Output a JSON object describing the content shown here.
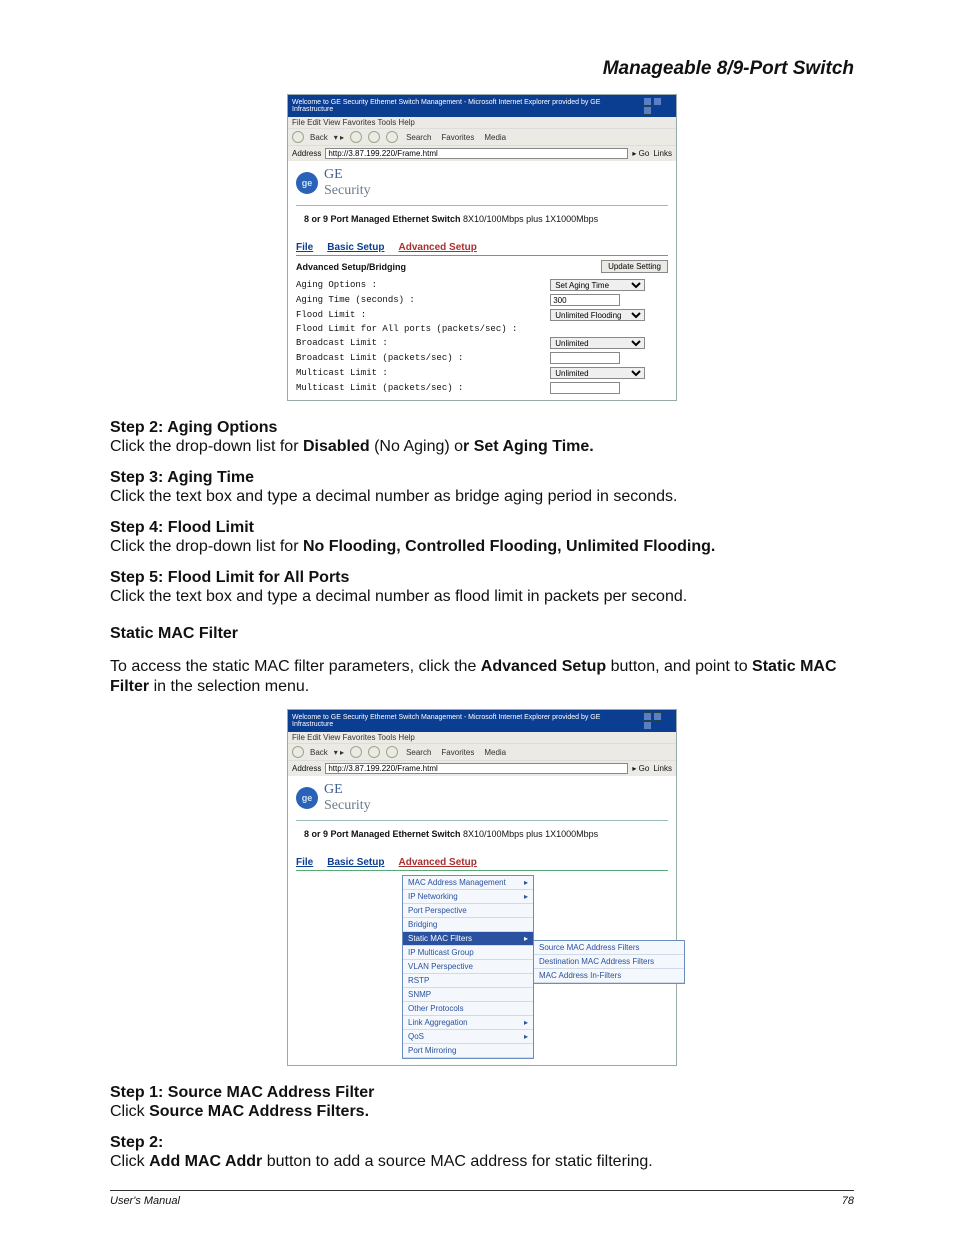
{
  "header": {
    "title": "Manageable 8/9-Port Switch"
  },
  "browser": {
    "title": "Welcome to GE Security Ethernet Switch Management - Microsoft Internet Explorer provided by GE Infrastructure",
    "menubar": "File   Edit   View   Favorites   Tools   Help",
    "toolbar": {
      "back": "Back",
      "search": "Search",
      "favorites": "Favorites",
      "media": "Media"
    },
    "address_label": "Address",
    "address_value": "http://3.87.199.220/Frame.html",
    "go": "Go",
    "links": "Links"
  },
  "ge": {
    "brand": "GE",
    "subbrand": "Security",
    "device_bold": "8 or 9 Port Managed Ethernet Switch",
    "device_rest": "  8X10/100Mbps plus 1X1000Mbps"
  },
  "tabs": {
    "file": "File",
    "basic": "Basic Setup",
    "advanced": "Advanced Setup"
  },
  "sc1": {
    "section": "Advanced Setup/Bridging",
    "update": "Update Setting",
    "labels": {
      "aging_options": "Aging Options :",
      "aging_time": "Aging Time (seconds) :",
      "flood_limit": "Flood Limit :",
      "flood_all": "Flood Limit for All ports (packets/sec) :",
      "bcast_limit": "Broadcast Limit :",
      "bcast_pkts": "Broadcast Limit (packets/sec) :",
      "mcast_limit": "Multicast Limit :",
      "mcast_pkts": "Multicast Limit (packets/sec) :"
    },
    "values": {
      "aging_options": "Set Aging Time",
      "aging_time": "300",
      "flood_limit": "Unlimited Flooding",
      "bcast_limit": "Unlimited",
      "mcast_limit": "Unlimited"
    }
  },
  "sc2": {
    "menu": {
      "mac_mgmt": "MAC Address Management",
      "ip_net": "IP Networking",
      "port_persp": "Port Perspective",
      "bridging": "Bridging",
      "static_mac": "Static MAC Filters",
      "ip_multicast": "IP Multicast Group",
      "vlan": "VLAN Perspective",
      "rstp": "RSTP",
      "snmp": "SNMP",
      "other": "Other Protocols",
      "link_agg": "Link Aggregation",
      "qos": "QoS",
      "port_mirror": "Port Mirroring"
    },
    "submenu": {
      "src": "Source MAC Address Filters",
      "dst": "Destination MAC Address Filters",
      "in": "MAC Address In-Filters"
    }
  },
  "steps": {
    "s2_title": "Step 2: Aging Options",
    "s2_body_a": "Click the drop-down list for ",
    "s2_body_b": "Disabled",
    "s2_body_c": " (No Aging) o",
    "s2_body_d": "r Set Aging Time.",
    "s3_title": "Step 3: Aging Time",
    "s3_body": "Click the text box and type a decimal number as bridge aging period in seconds.",
    "s4_title": "Step 4: Flood Limit",
    "s4_body_a": "Click the drop-down list for ",
    "s4_body_b": "No Flooding, Controlled Flooding, Unlimited Flooding.",
    "s5_title": "Step 5: Flood Limit for All Ports",
    "s5_body": "Click the text box and type a decimal number as flood limit in packets per second.",
    "static_title": "Static MAC Filter",
    "static_body_a": "To access the static MAC filter parameters, click the ",
    "static_body_b": "Advanced Setup",
    "static_body_c": " button, and point to ",
    "static_body_d": "Static MAC Filter",
    "static_body_e": " in the selection menu.",
    "b1_title": "Step 1: Source MAC Address Filter",
    "b1_body_a": "Click ",
    "b1_body_b": "Source MAC Address Filters.",
    "b2_title": "Step 2:",
    "b2_body_a": "Click ",
    "b2_body_b": "Add MAC Addr",
    "b2_body_c": " button to add a source MAC address for static filtering."
  },
  "footer": {
    "left": "User's Manual",
    "right": "78"
  }
}
